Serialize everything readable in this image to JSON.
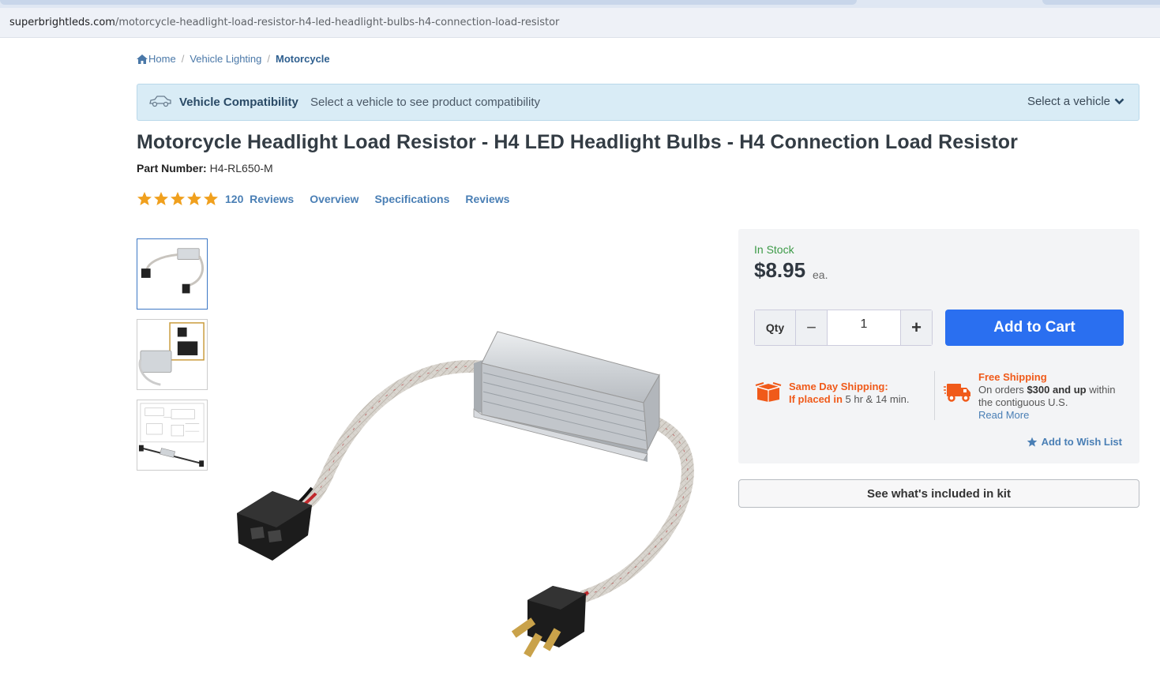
{
  "browser": {
    "url_domain": "superbrightleds.com",
    "url_path": "/motorcycle-headlight-load-resistor-h4-led-headlight-bulbs-h4-connection-load-resistor"
  },
  "breadcrumb": {
    "items": [
      "Home",
      "Vehicle Lighting",
      "Motorcycle"
    ],
    "separator": "/"
  },
  "vehicle_bar": {
    "title": "Vehicle Compatibility",
    "text": "Select a vehicle to see product compatibility",
    "select_label": "Select a vehicle"
  },
  "product": {
    "title": "Motorcycle Headlight Load Resistor - H4 LED Headlight Bulbs - H4 Connection Load Resistor",
    "part_label": "Part Number:",
    "part_number": "H4-RL650-M",
    "rating": 5,
    "review_count": "120",
    "reviews_label": "Reviews",
    "nav": [
      "Overview",
      "Specifications",
      "Reviews"
    ]
  },
  "buybox": {
    "stock": "In Stock",
    "price": "$8.95",
    "unit": "ea.",
    "qty_label": "Qty",
    "qty_value": "1",
    "add_to_cart": "Add to Cart",
    "same_day_title": "Same Day Shipping:",
    "same_day_prefix": "If placed in",
    "same_day_time": "5 hr & 14 min.",
    "free_title": "Free Shipping",
    "free_line1_pre": "On orders",
    "free_amount": "$300 and up",
    "free_line1_post": "within",
    "free_line2": "the contiguous U.S.",
    "read_more": "Read More",
    "wishlist": "Add to Wish List"
  },
  "kit_button": "See what's included in kit",
  "colors": {
    "accent": "#2a6ff0",
    "link": "#4a7fb5",
    "stock_green": "#3c9a47",
    "shipping_orange": "#f05a1a",
    "star": "#f0a01e"
  },
  "icons": [
    "home-icon",
    "car-icon",
    "chevron-down-icon",
    "star-icon",
    "box-icon",
    "truck-icon"
  ]
}
